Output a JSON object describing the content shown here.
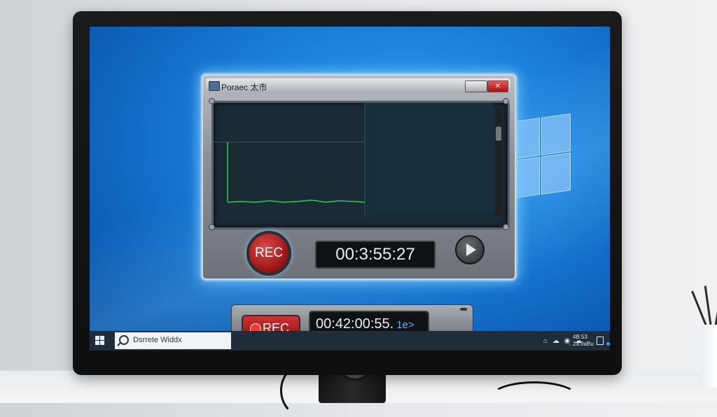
{
  "recorder": {
    "title": "Poraec 太市",
    "min_btn_label": "",
    "close_btn_label": "✕",
    "rec_label": "REC",
    "timer": "00:3:55:27"
  },
  "toolbar": {
    "rec_label": "REC",
    "timer": "00:42:00:55.",
    "timer_suffix": "1e>"
  },
  "taskbar": {
    "search_text": "Dsrrete Widdx",
    "tray_icons": "⌂ ☁ ◉ ☁",
    "tray_time_line1": "4B:53",
    "tray_time_line2": "2a.9aBu"
  },
  "colors": {
    "desktop_blue": "#1a7fd8",
    "rec_red": "#d03232",
    "glow": "#78c8ff",
    "waveform_green": "#2ecc52"
  },
  "icons": [
    "window-app-icon",
    "play-icon",
    "record-dot-icon",
    "windows-start-icon",
    "search-icon",
    "notification-icon"
  ]
}
